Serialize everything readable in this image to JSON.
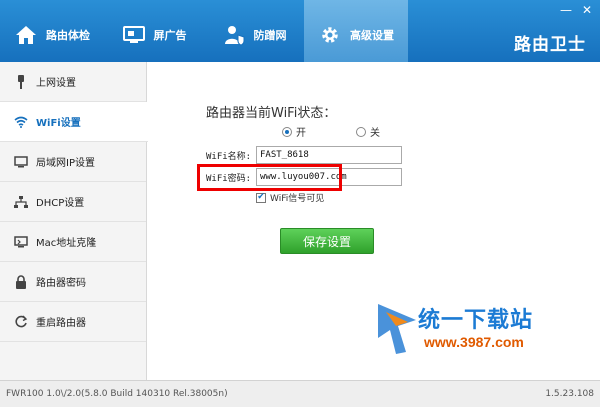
{
  "window": {
    "minimize": "—",
    "close": "✕"
  },
  "nav": {
    "tabs": [
      {
        "label": "路由体检",
        "icon": "home-icon"
      },
      {
        "label": "屏广告",
        "icon": "screen-icon"
      },
      {
        "label": "防蹭网",
        "icon": "user-shield-icon"
      },
      {
        "label": "高级设置",
        "icon": "gear-icon"
      }
    ],
    "active": 3,
    "brand": "路由卫士"
  },
  "sidebar": {
    "items": [
      {
        "label": "上网设置",
        "icon": "cable-icon"
      },
      {
        "label": "WiFi设置",
        "icon": "wifi-icon"
      },
      {
        "label": "局域网IP设置",
        "icon": "monitor-icon"
      },
      {
        "label": "DHCP设置",
        "icon": "network-icon"
      },
      {
        "label": "Mac地址克隆",
        "icon": "mac-icon"
      },
      {
        "label": "路由器密码",
        "icon": "lock-icon"
      },
      {
        "label": "重启路由器",
        "icon": "restart-icon"
      }
    ],
    "active": 1
  },
  "main": {
    "status_title": "路由器当前WiFi状态：",
    "radio_on": "开",
    "radio_off": "关",
    "ssid_label": "WiFi名称:",
    "ssid_value": "FAST_8618",
    "password_label": "WiFi密码:",
    "password_value": "www.luyou007.com",
    "show_password_label": "WiFi信号可见",
    "save_label": "保存设置"
  },
  "watermark": {
    "name": "统一下载站",
    "url": "www.3987.com"
  },
  "footer": {
    "firmware": "FWR100 1.0\\/2.0(5.8.0 Build 140310 Rel.38005n)",
    "version": "1.5.23.108"
  },
  "colors": {
    "header": "#1670bd",
    "active_tab": "#5aa6dd",
    "save_button": "#3db439",
    "highlight": "#e00000"
  }
}
